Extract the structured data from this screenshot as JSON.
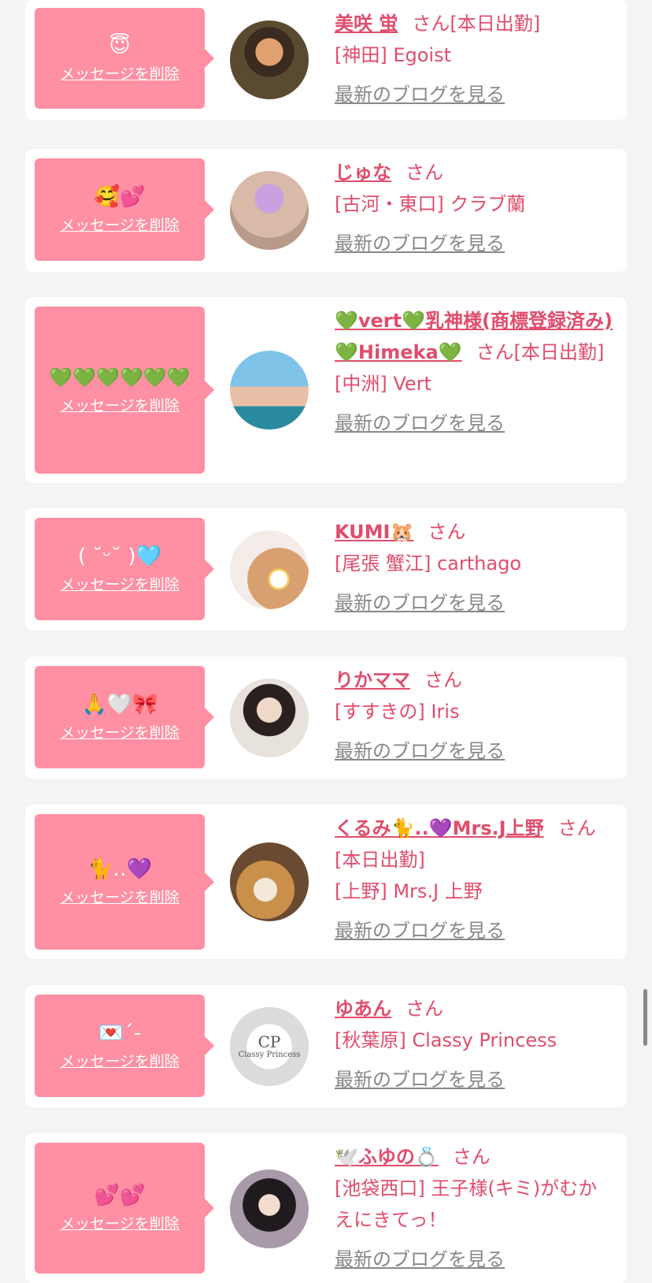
{
  "entries": [
    {
      "emoji": "😇",
      "delete_label": "メッセージを削除",
      "name": "美咲 蛍",
      "honorific": "さん",
      "status": "[本日出勤]",
      "location": "[神田] Egoist",
      "blog_link": "最新のブログを見る"
    },
    {
      "emoji": "🥰💕",
      "delete_label": "メッセージを削除",
      "name": "じゅな",
      "honorific": "さん",
      "status": "",
      "location": "[古河・東口] クラブ蘭",
      "blog_link": "最新のブログを見る"
    },
    {
      "emoji": "💚💚💚💚💚💚",
      "delete_label": "メッセージを削除",
      "name": "💚vert💚乳神様(商標登録済み)💚Himeka💚",
      "honorific": "さん",
      "status": "[本日出勤]",
      "location": "[中洲] Vert",
      "blog_link": "最新のブログを見る"
    },
    {
      "emoji": "( ˘ᵕ˘ )🩵",
      "delete_label": "メッセージを削除",
      "name": "KUMI🐹",
      "honorific": "さん",
      "status": "",
      "location": "[尾張 蟹江] carthago",
      "blog_link": "最新のブログを見る"
    },
    {
      "emoji": "🙏🤍🎀",
      "delete_label": "メッセージを削除",
      "name": "りかママ",
      "honorific": "さん",
      "status": "",
      "location": "[すすきの] Iris",
      "blog_link": "最新のブログを見る"
    },
    {
      "emoji": "🐈‥💜",
      "delete_label": "メッセージを削除",
      "name": "くるみ🐈..💜Mrs.J上野",
      "honorific": "さん",
      "status": "[本日出勤]",
      "location": "[上野] Mrs.J 上野",
      "blog_link": "最新のブログを見る"
    },
    {
      "emoji": "💌´-",
      "delete_label": "メッセージを削除",
      "name": "ゆあん",
      "honorific": "さん",
      "status": "",
      "location": "[秋葉原] Classy Princess",
      "blog_link": "最新のブログを見る",
      "avatar_text": "Classy Princess"
    },
    {
      "emoji": "💕💕",
      "delete_label": "メッセージを削除",
      "name": "🕊️ふゆの💍",
      "honorific": "さん",
      "status": "",
      "location": "[池袋西口] 王子様(キミ)がむかえにきてっ！",
      "blog_link": "最新のブログを見る"
    }
  ],
  "colors": {
    "accent": "#e04d6c",
    "bubble": "#ff8fa3",
    "link_gray": "#888888"
  }
}
